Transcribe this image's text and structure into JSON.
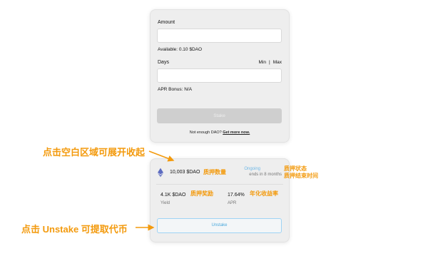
{
  "stake_form": {
    "amount_label": "Amount",
    "amount_value": "",
    "available_text": "Available: 0.10 $DAO",
    "days_label": "Days",
    "min_label": "Min",
    "separator": "|",
    "max_label": "Max",
    "days_value": "",
    "apr_bonus_text": "APR Bonus: N/A",
    "stake_button": "Stake",
    "not_enough_text": "Not enough DAO?",
    "get_more_link": "Get more now."
  },
  "position": {
    "amount": "10,003 $DAO",
    "status": "Ongoing",
    "ends_text": "ends in 8 months",
    "yield_value": "4.1K $DAO",
    "yield_label": "Yield",
    "apr_value": "17.64%",
    "apr_label": "APR",
    "unstake_button": "Unstake"
  },
  "annotations": {
    "collapse_hint": "点击空白区域可展开收起",
    "stake_amount": "质押数量",
    "stake_status": "质押状态",
    "stake_end_time": "质押结束时间",
    "stake_reward": "质押奖励",
    "annual_yield": "年化收益率",
    "unstake_hint": "点击 Unstake 可提取代币"
  },
  "colors": {
    "annotation": "#f39a0d",
    "ongoing": "#6fb8e6",
    "unstake": "#4aa8dc"
  }
}
